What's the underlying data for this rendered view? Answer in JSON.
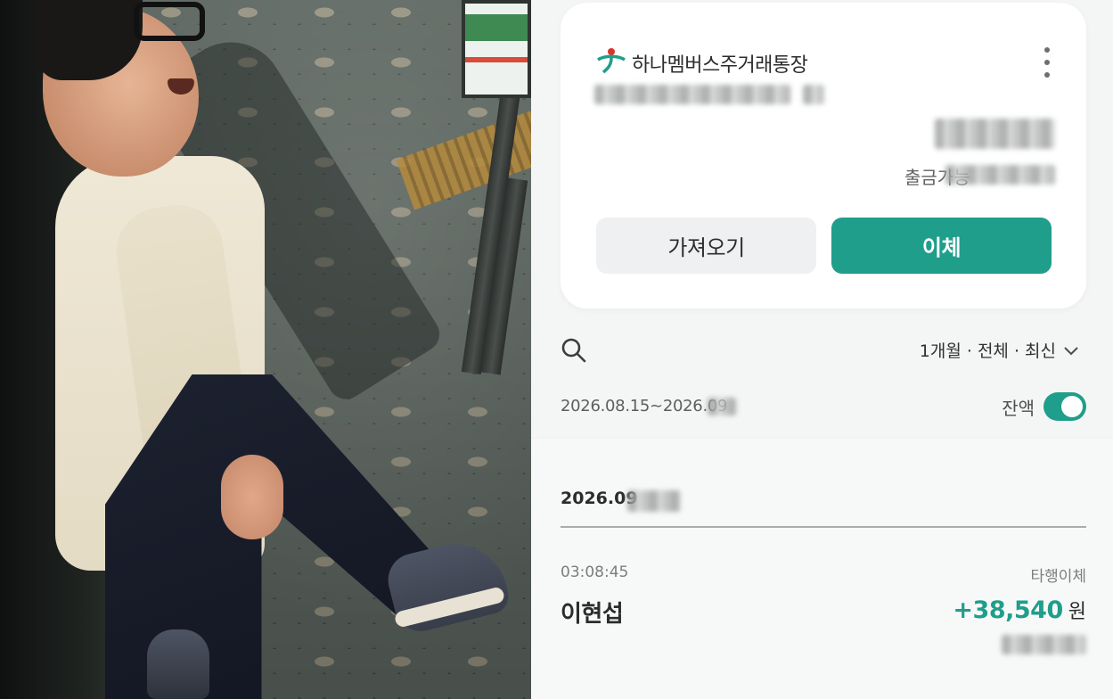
{
  "account": {
    "name": "하나멤버스주거래통장",
    "withdraw_label": "출금가능"
  },
  "buttons": {
    "get_label": "가져오기",
    "transfer_label": "이체"
  },
  "filters": {
    "summary": "1개월 · 전체 · 최신",
    "date_range": "2026.08.15~2026.09",
    "balance_label": "잔액",
    "balance_toggle_on": true
  },
  "transactions": {
    "group_date": "2026.09",
    "items": [
      {
        "time": "03:08:45",
        "type": "타행이체",
        "name": "이현섭",
        "amount": "+38,540",
        "unit": "원"
      }
    ]
  },
  "colors": {
    "accent": "#1f9e8b",
    "card_bg": "#ffffff",
    "app_bg": "#f4f6f5"
  },
  "icons": {
    "logo": "hana-bank-logo",
    "more": "more-vertical-icon",
    "search": "search-icon",
    "chevron": "chevron-down-icon"
  }
}
